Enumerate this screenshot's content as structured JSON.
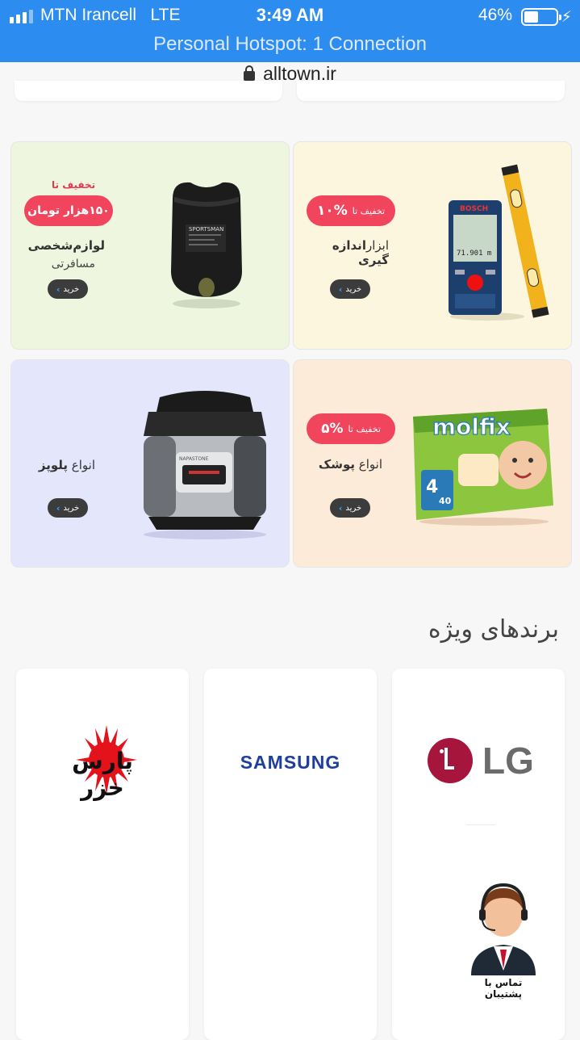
{
  "status_bar": {
    "carrier": "MTN Irancell",
    "network": "LTE",
    "time": "3:49 AM",
    "battery_percent": "46%",
    "battery_level": 0.46,
    "hotspot": "Personal Hotspot: 1 Connection"
  },
  "browser": {
    "url": "alltown.ir"
  },
  "banners": [
    {
      "discount_label": "تخفیف تا",
      "pill_amount": "۱۵۰هزار تومان",
      "title": "لوازم‌شخصی",
      "subtitle": "مسافرتی",
      "buy": "خرید",
      "product_text": "SPORTSMAN"
    },
    {
      "pill_prefix": "تخفیف تا",
      "pill_amount": "۱۰%",
      "title_light": "ابزار",
      "title_bold": "اندازه گیری",
      "buy": "خرید",
      "product_text": "BOSCH",
      "product_reading": "71.901 m"
    },
    {
      "title_light": "انواع",
      "title_bold": "پلوپز",
      "buy": "خرید",
      "product_text": "NAPASTONE"
    },
    {
      "pill_prefix": "تخفیف تا",
      "pill_amount": "۵%",
      "title_light": "انواع",
      "title_bold": "پوشک",
      "buy": "خرید",
      "product_brand": "molfix",
      "product_size": "4",
      "product_count": "40"
    }
  ],
  "brands_section": {
    "title": "برندهای ویژه",
    "brands": [
      "پارس خزر",
      "SAMSUNG",
      "LG"
    ]
  },
  "support": {
    "label": "تماس با پشتیبان"
  },
  "colors": {
    "status_bar": "#2d8cf0",
    "pill": "#f0455d",
    "lg": "#a6153c",
    "samsung": "#1e3f9e"
  }
}
